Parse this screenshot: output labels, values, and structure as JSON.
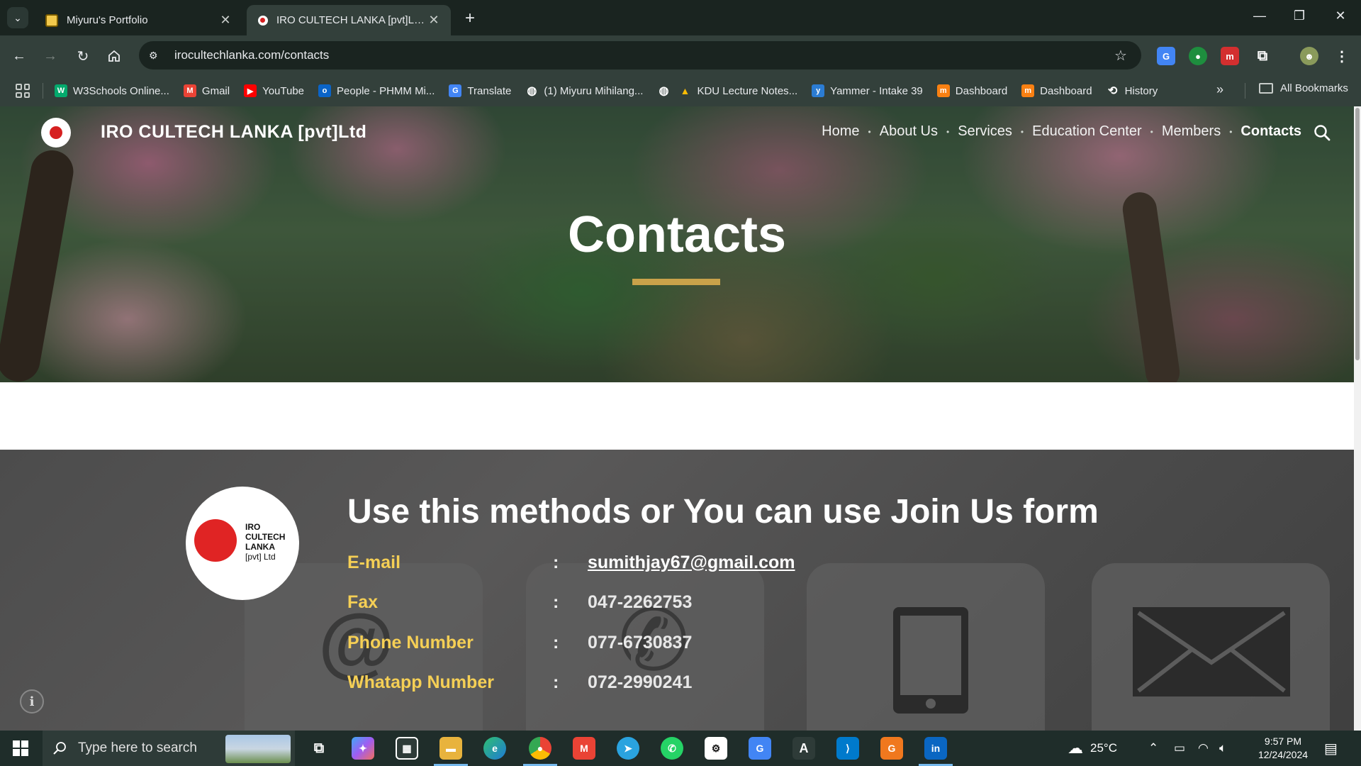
{
  "browser": {
    "tabs": [
      {
        "title": "Miyuru's Portfolio",
        "active": false
      },
      {
        "title": "IRO CULTECH LANKA [pvt]Ltd - ",
        "active": true
      }
    ],
    "url": "irocultechlanka.com/contacts",
    "bookmarks": [
      {
        "label": "W3Schools Online...",
        "icon": "w3schools-icon",
        "color": "#04aa6d",
        "glyph": "W"
      },
      {
        "label": "Gmail",
        "icon": "gmail-icon",
        "color": "#ea4335",
        "glyph": "M"
      },
      {
        "label": "YouTube",
        "icon": "youtube-icon",
        "color": "#ff0000",
        "glyph": "▶"
      },
      {
        "label": "People - PHMM Mi...",
        "icon": "outlook-icon",
        "color": "#0a64c8",
        "glyph": "o"
      },
      {
        "label": "Translate",
        "icon": "google-translate-icon",
        "color": "#4285f4",
        "glyph": "G"
      },
      {
        "label": "(1) Miyuru Mihilang...",
        "icon": "globe-icon",
        "color": "#33403b",
        "glyph": "◍"
      },
      {
        "label": "",
        "icon": "globe-icon",
        "color": "#33403b",
        "glyph": "◍"
      },
      {
        "label": "KDU Lecture Notes...",
        "icon": "google-drive-icon",
        "color": "#1fa463",
        "glyph": "▲"
      },
      {
        "label": "Yammer - Intake 39",
        "icon": "yammer-icon",
        "color": "#2b7cd3",
        "glyph": "y"
      },
      {
        "label": "Dashboard",
        "icon": "moodle-icon",
        "color": "#f98012",
        "glyph": "m"
      },
      {
        "label": "Dashboard",
        "icon": "moodle-icon",
        "color": "#f98012",
        "glyph": "m"
      },
      {
        "label": "History",
        "icon": "history-icon",
        "color": "#33403b",
        "glyph": "⟲"
      }
    ],
    "all_bookmarks_label": "All Bookmarks"
  },
  "site": {
    "brand": "IRO CULTECH LANKA [pvt]Ltd",
    "nav": [
      {
        "label": "Home",
        "active": false
      },
      {
        "label": "About Us",
        "active": false
      },
      {
        "label": "Services",
        "active": false
      },
      {
        "label": "Education Center",
        "active": false
      },
      {
        "label": "Members",
        "active": false
      },
      {
        "label": "Contacts",
        "active": true
      }
    ],
    "hero_title": "Contacts",
    "accent_color": "#c9a24a"
  },
  "contact": {
    "logo_text": [
      "IRO",
      "CULTECH",
      "LANKA",
      "[pvt] Ltd"
    ],
    "heading": "Use this methods or You can use Join Us form",
    "rows": [
      {
        "label": "E-mail",
        "colon": ":",
        "value": "sumithjay67@gmail.com",
        "link": true
      },
      {
        "label": "Fax",
        "colon": ":",
        "value": "047-2262753",
        "link": false
      },
      {
        "label": "Phone Number",
        "colon": ":",
        "value": "077-6730837",
        "link": false
      },
      {
        "label": "Whatapp Number",
        "colon": ":",
        "value": "072-2990241",
        "link": false
      }
    ],
    "label_color": "#f5cf55"
  },
  "taskbar": {
    "search_placeholder": "Type here to search",
    "weather": "25°C",
    "time": "9:57 PM",
    "date": "12/24/2024"
  }
}
